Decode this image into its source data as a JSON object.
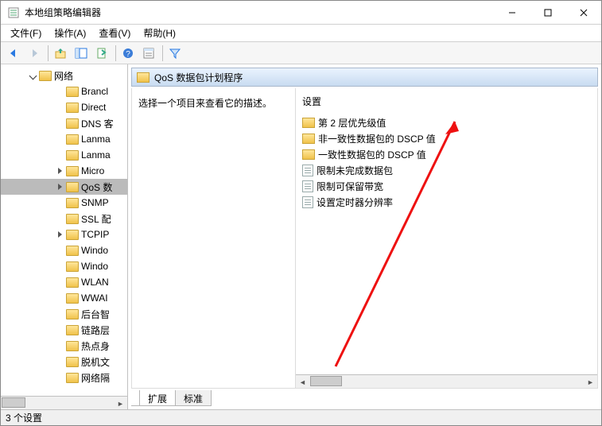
{
  "title": "本地组策略编辑器",
  "menu": {
    "file": "文件(F)",
    "action": "操作(A)",
    "view": "查看(V)",
    "help": "帮助(H)"
  },
  "tree": {
    "root": "网络",
    "items": [
      {
        "label": "Brancl",
        "sel": false,
        "exp": false,
        "kids": false
      },
      {
        "label": "Direct",
        "sel": false,
        "exp": false,
        "kids": false
      },
      {
        "label": "DNS 客",
        "sel": false,
        "exp": false,
        "kids": false
      },
      {
        "label": "Lanma",
        "sel": false,
        "exp": false,
        "kids": false
      },
      {
        "label": "Lanma",
        "sel": false,
        "exp": false,
        "kids": false
      },
      {
        "label": "Micro",
        "sel": false,
        "exp": false,
        "kids": true
      },
      {
        "label": "QoS 数",
        "sel": true,
        "exp": false,
        "kids": true
      },
      {
        "label": "SNMP",
        "sel": false,
        "exp": false,
        "kids": false
      },
      {
        "label": "SSL 配",
        "sel": false,
        "exp": false,
        "kids": false
      },
      {
        "label": "TCPIP",
        "sel": false,
        "exp": false,
        "kids": true
      },
      {
        "label": "Windo",
        "sel": false,
        "exp": false,
        "kids": false
      },
      {
        "label": "Windo",
        "sel": false,
        "exp": false,
        "kids": false
      },
      {
        "label": "WLAN",
        "sel": false,
        "exp": false,
        "kids": false
      },
      {
        "label": "WWAI",
        "sel": false,
        "exp": false,
        "kids": false
      },
      {
        "label": "后台智",
        "sel": false,
        "exp": false,
        "kids": false
      },
      {
        "label": "链路层",
        "sel": false,
        "exp": false,
        "kids": false
      },
      {
        "label": "热点身",
        "sel": false,
        "exp": false,
        "kids": false
      },
      {
        "label": "脱机文",
        "sel": false,
        "exp": false,
        "kids": false
      },
      {
        "label": "网络隔",
        "sel": false,
        "exp": false,
        "kids": false
      }
    ]
  },
  "header": "QoS 数据包计划程序",
  "hint": "选择一个项目来查看它的描述。",
  "settings_header": "设置",
  "list": [
    {
      "type": "folder",
      "label": "第 2 层优先级值"
    },
    {
      "type": "folder",
      "label": "非一致性数据包的 DSCP 值"
    },
    {
      "type": "folder",
      "label": "一致性数据包的 DSCP 值"
    },
    {
      "type": "doc",
      "label": "限制未完成数据包"
    },
    {
      "type": "doc",
      "label": "限制可保留带宽"
    },
    {
      "type": "doc",
      "label": "设置定时器分辨率"
    }
  ],
  "tabs": {
    "ext": "扩展",
    "std": "标准"
  },
  "status": "3 个设置"
}
